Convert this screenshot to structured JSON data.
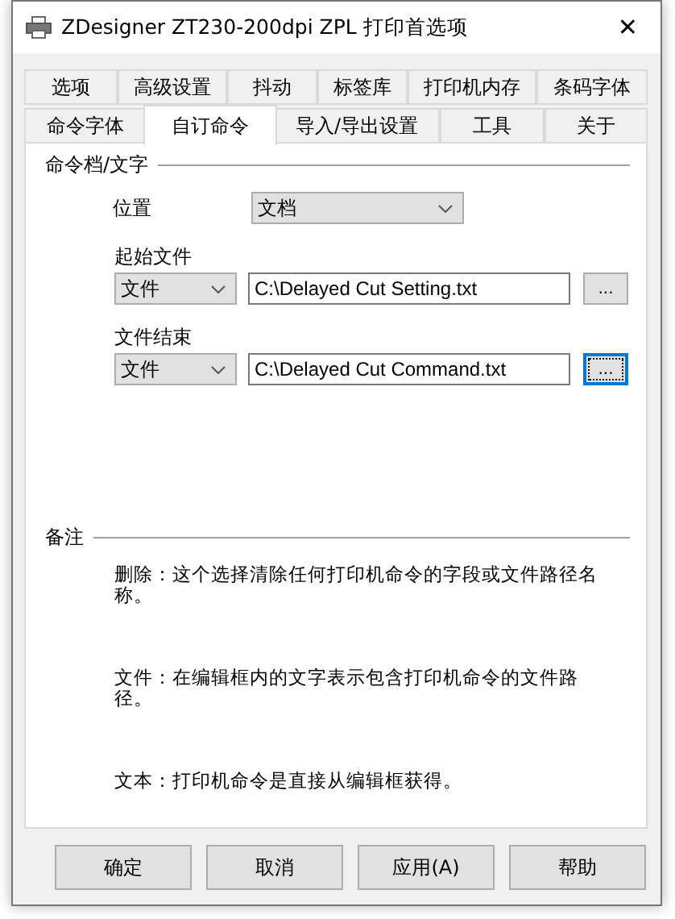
{
  "window": {
    "title": "ZDesigner ZT230-200dpi ZPL 打印首选项",
    "close": "✕"
  },
  "tab_rows": [
    [
      {
        "label": "选项",
        "selected": false
      },
      {
        "label": "高级设置",
        "selected": false
      },
      {
        "label": "抖动",
        "selected": false
      },
      {
        "label": "标签库",
        "selected": false
      },
      {
        "label": "打印机内存",
        "selected": false
      },
      {
        "label": "条码字体",
        "selected": false
      }
    ],
    [
      {
        "label": "命令字体",
        "selected": false
      },
      {
        "label": "自订命令",
        "selected": true
      },
      {
        "label": "导入/导出设置",
        "selected": false
      },
      {
        "label": "工具",
        "selected": false
      },
      {
        "label": "关于",
        "selected": false
      }
    ]
  ],
  "command_group": {
    "title": "命令档/文字",
    "location": {
      "label": "位置",
      "value": "文档"
    },
    "rows": [
      {
        "label": "起始文件",
        "type": "文件",
        "path": "C:\\Delayed Cut Setting.txt",
        "browse": "...",
        "focused": false
      },
      {
        "label": "文件结束",
        "type": "文件",
        "path": "C:\\Delayed Cut Command.txt",
        "browse": "...",
        "focused": true
      }
    ]
  },
  "notes": {
    "title": "备注",
    "items": [
      "删除：这个选择清除任何打印机命令的字段或文件路径名称。",
      "文件：在编辑框内的文字表示包含打印机命令的文件路径。",
      "文本：打印机命令是直接从编辑框获得。"
    ]
  },
  "buttons": [
    "确定",
    "取消",
    "应用(A)",
    "帮助"
  ]
}
